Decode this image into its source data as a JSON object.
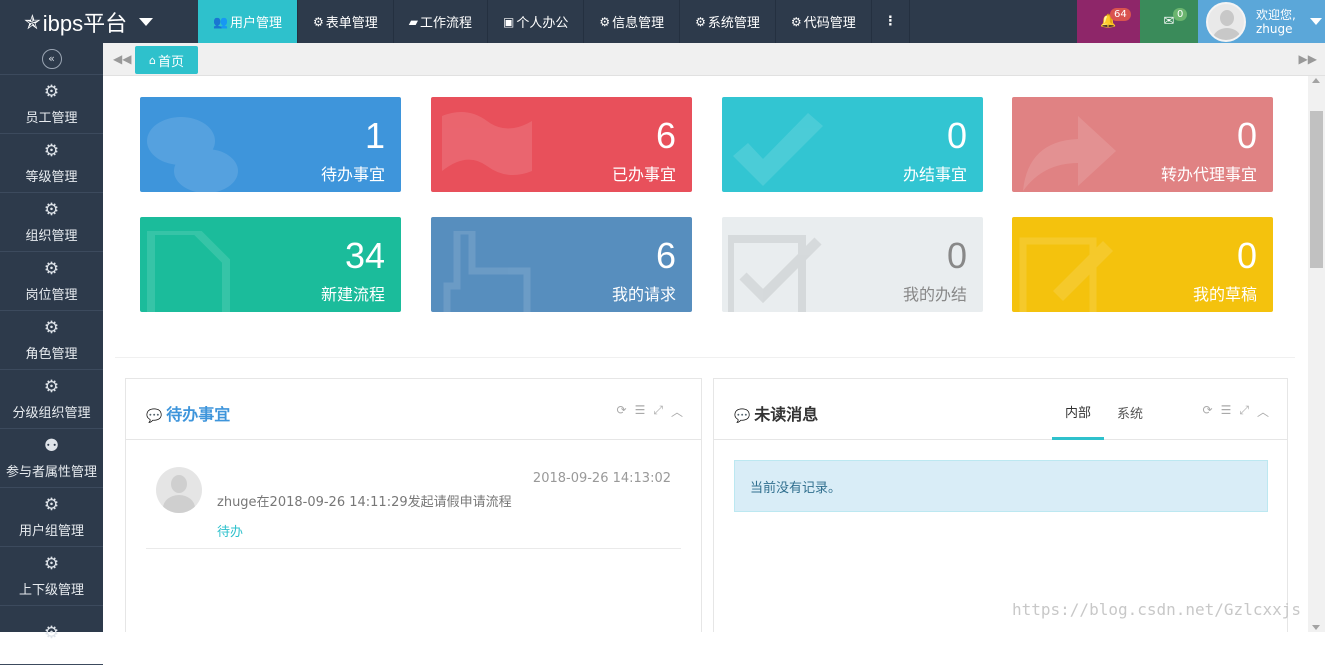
{
  "brand": {
    "name": "ibps平台"
  },
  "nav": {
    "items": [
      {
        "label": "用户管理",
        "icon": "users-icon"
      },
      {
        "label": "表单管理",
        "icon": "gear-icon"
      },
      {
        "label": "工作流程",
        "icon": "flow-icon"
      },
      {
        "label": "个人办公",
        "icon": "briefcase-icon"
      },
      {
        "label": "信息管理",
        "icon": "gear-icon"
      },
      {
        "label": "系统管理",
        "icon": "gear-icon"
      },
      {
        "label": "代码管理",
        "icon": "gear-icon"
      }
    ],
    "more": "⋮"
  },
  "header_right": {
    "notifications": "64",
    "messages": "0",
    "welcome": "欢迎您,",
    "username": "zhuge"
  },
  "sidebar": {
    "items": [
      {
        "label": "员工管理"
      },
      {
        "label": "等级管理"
      },
      {
        "label": "组织管理"
      },
      {
        "label": "岗位管理"
      },
      {
        "label": "角色管理"
      },
      {
        "label": "分级组织管理"
      },
      {
        "label": "参与者属性管理"
      },
      {
        "label": "用户组管理"
      },
      {
        "label": "上下级管理"
      }
    ]
  },
  "tabs": {
    "home": "首页"
  },
  "stats": [
    {
      "value": "1",
      "label": "待办事宜",
      "color": "#3e95db"
    },
    {
      "value": "6",
      "label": "已办事宜",
      "color": "#e8505b"
    },
    {
      "value": "0",
      "label": "办结事宜",
      "color": "#32c5d2"
    },
    {
      "value": "0",
      "label": "转办代理事宜",
      "color": "#e08283"
    },
    {
      "value": "34",
      "label": "新建流程",
      "color": "#1bbc9b"
    },
    {
      "value": "6",
      "label": "我的请求",
      "color": "#578ebe"
    },
    {
      "value": "0",
      "label": "我的办结",
      "color": "#e9edef"
    },
    {
      "value": "0",
      "label": "我的草稿",
      "color": "#f4c20d"
    }
  ],
  "todo_panel": {
    "title": "待办事宜",
    "items": [
      {
        "time": "2018-09-26 14:13:02",
        "text": "zhuge在2018-09-26 14:11:29发起请假申请流程",
        "status": "待办"
      }
    ]
  },
  "message_panel": {
    "title": "未读消息",
    "tabs": [
      "内部",
      "系统"
    ],
    "empty": "当前没有记录。"
  },
  "watermark": "https://blog.csdn.net/Gzlcxxjs"
}
